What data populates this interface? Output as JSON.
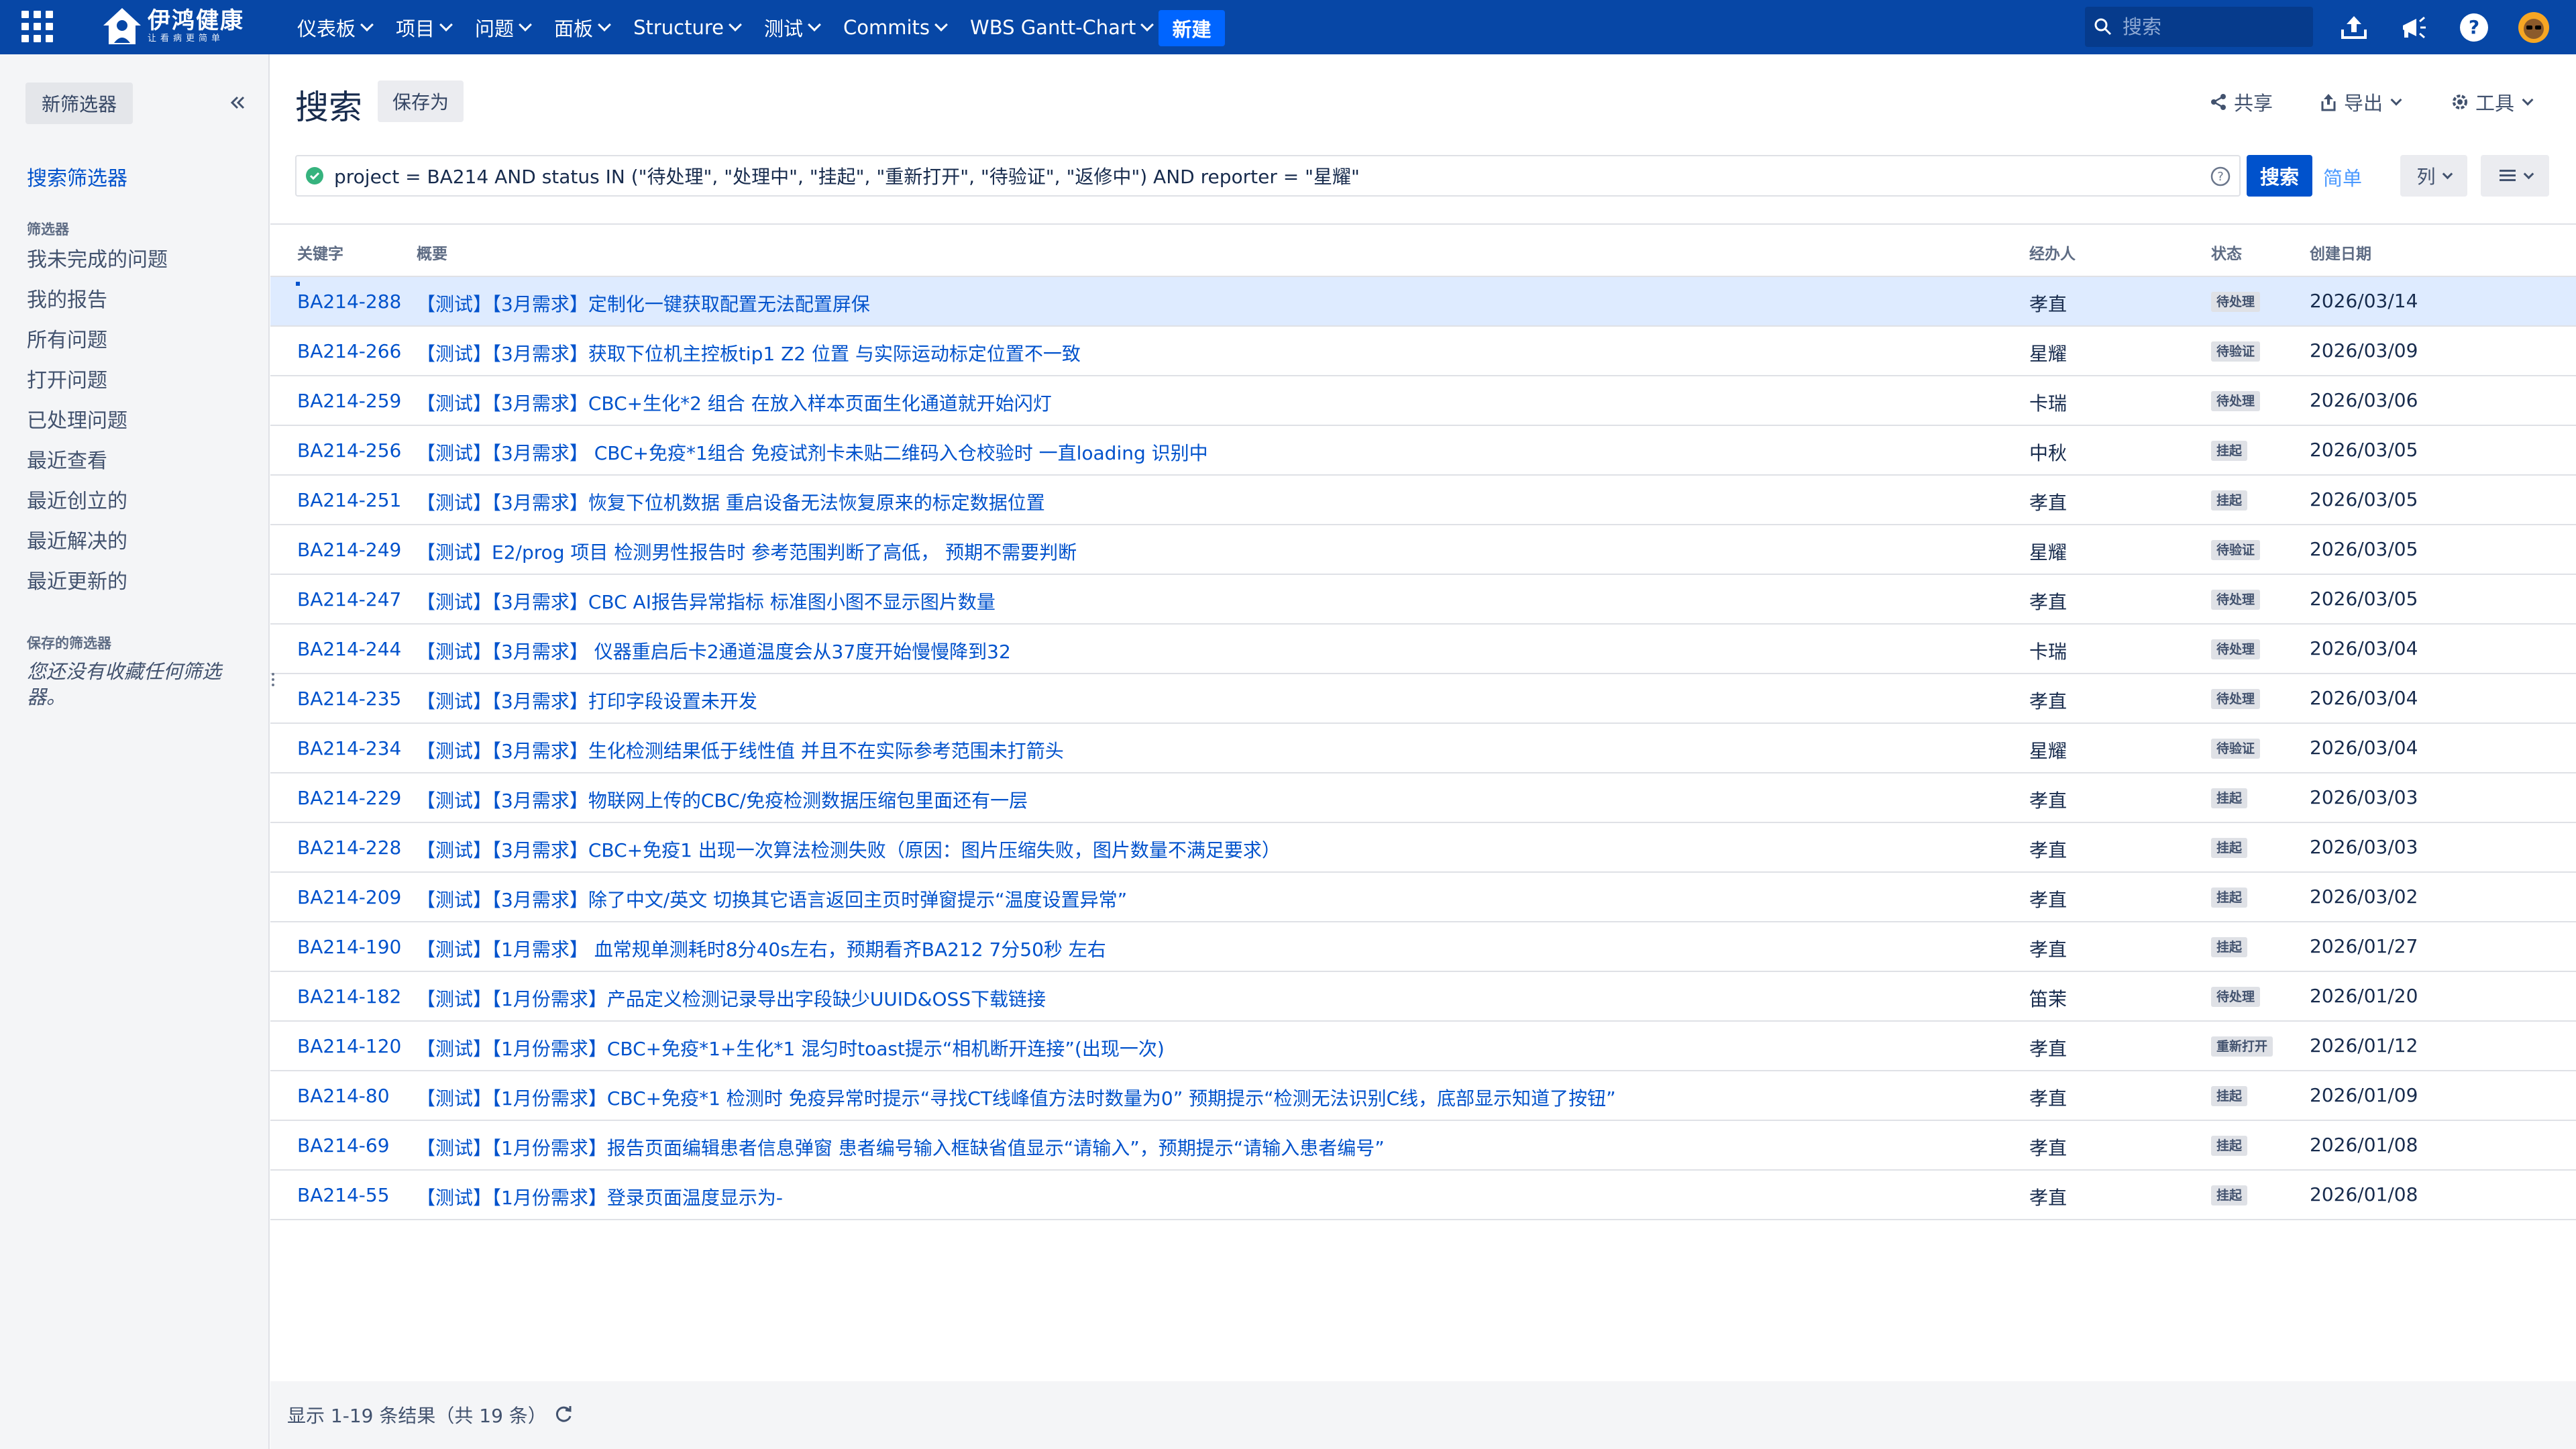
{
  "brand": {
    "name": "伊鸿健康",
    "tagline": "让看病更简单"
  },
  "nav": {
    "menus": [
      "仪表板",
      "项目",
      "问题",
      "面板",
      "Structure",
      "测试",
      "Commits",
      "WBS Gantt-Chart"
    ],
    "create_label": "新建",
    "search_placeholder": "搜索"
  },
  "sidebar": {
    "new_filter_label": "新筛选器",
    "find_filters_label": "搜索筛选器",
    "filters_heading": "筛选器",
    "filters": [
      "我未完成的问题",
      "我的报告",
      "所有问题",
      "打开问题",
      "已处理问题",
      "最近查看",
      "最近创立的",
      "最近解决的",
      "最近更新的"
    ],
    "saved_heading": "保存的筛选器",
    "saved_empty": "您还没有收藏任何筛选器。"
  },
  "header": {
    "title": "搜索",
    "save_as_label": "保存为",
    "share_label": "共享",
    "export_label": "导出",
    "tools_label": "工具"
  },
  "query": {
    "jql": "project = BA214 AND status IN (\"待处理\", \"处理中\", \"挂起\", \"重新打开\", \"待验证\", \"返修中\") AND reporter = \"星耀\"",
    "search_label": "搜索",
    "basic_label": "简单",
    "columns_label": "列"
  },
  "table": {
    "headers": {
      "key": "关键字",
      "summary": "概要",
      "assignee": "经办人",
      "status": "状态",
      "created": "创建日期"
    },
    "rows": [
      {
        "key": "BA214-288",
        "summary": "【测试】【3月需求】定制化一键获取配置无法配置屏保",
        "assignee": "孝直",
        "status": "待处理",
        "created": "2026/03/14"
      },
      {
        "key": "BA214-266",
        "summary": "【测试】【3月需求】获取下位机主控板tip1 Z2 位置 与实际运动标定位置不一致",
        "assignee": "星耀",
        "status": "待验证",
        "created": "2026/03/09"
      },
      {
        "key": "BA214-259",
        "summary": "【测试】【3月需求】CBC+生化*2 组合 在放入样本页面生化通道就开始闪灯",
        "assignee": "卡瑞",
        "status": "待处理",
        "created": "2026/03/06"
      },
      {
        "key": "BA214-256",
        "summary": "【测试】【3月需求】 CBC+免疫*1组合 免疫试剂卡未贴二维码入仓校验时 一直loading 识别中",
        "assignee": "中秋",
        "status": "挂起",
        "created": "2026/03/05"
      },
      {
        "key": "BA214-251",
        "summary": "【测试】【3月需求】恢复下位机数据 重启设备无法恢复原来的标定数据位置",
        "assignee": "孝直",
        "status": "挂起",
        "created": "2026/03/05"
      },
      {
        "key": "BA214-249",
        "summary": "【测试】E2/prog 项目 检测男性报告时 参考范围判断了高低， 预期不需要判断",
        "assignee": "星耀",
        "status": "待验证",
        "created": "2026/03/05"
      },
      {
        "key": "BA214-247",
        "summary": "【测试】【3月需求】CBC AI报告异常指标 标准图小图不显示图片数量",
        "assignee": "孝直",
        "status": "待处理",
        "created": "2026/03/05"
      },
      {
        "key": "BA214-244",
        "summary": "【测试】【3月需求】 仪器重启后卡2通道温度会从37度开始慢慢降到32",
        "assignee": "卡瑞",
        "status": "待处理",
        "created": "2026/03/04"
      },
      {
        "key": "BA214-235",
        "summary": "【测试】【3月需求】打印字段设置未开发",
        "assignee": "孝直",
        "status": "待处理",
        "created": "2026/03/04"
      },
      {
        "key": "BA214-234",
        "summary": "【测试】【3月需求】生化检测结果低于线性值 并且不在实际参考范围未打箭头",
        "assignee": "星耀",
        "status": "待验证",
        "created": "2026/03/04"
      },
      {
        "key": "BA214-229",
        "summary": "【测试】【3月需求】物联网上传的CBC/免疫检测数据压缩包里面还有一层",
        "assignee": "孝直",
        "status": "挂起",
        "created": "2026/03/03"
      },
      {
        "key": "BA214-228",
        "summary": "【测试】【3月需求】CBC+免疫1 出现一次算法检测失败（原因：图片压缩失败，图片数量不满足要求）",
        "assignee": "孝直",
        "status": "挂起",
        "created": "2026/03/03"
      },
      {
        "key": "BA214-209",
        "summary": "【测试】【3月需求】除了中文/英文 切换其它语言返回主页时弹窗提示“温度设置异常”",
        "assignee": "孝直",
        "status": "挂起",
        "created": "2026/03/02"
      },
      {
        "key": "BA214-190",
        "summary": "【测试】【1月需求】 血常规单测耗时8分40s左右，预期看齐BA212 7分50秒 左右",
        "assignee": "孝直",
        "status": "挂起",
        "created": "2026/01/27"
      },
      {
        "key": "BA214-182",
        "summary": "【测试】【1月份需求】产品定义检测记录导出字段缺少UUID&OSS下载链接",
        "assignee": "笛茉",
        "status": "待处理",
        "created": "2026/01/20"
      },
      {
        "key": "BA214-120",
        "summary": "【测试】【1月份需求】CBC+免疫*1+生化*1 混匀时toast提示“相机断开连接”(出现一次)",
        "assignee": "孝直",
        "status": "重新打开",
        "created": "2026/01/12"
      },
      {
        "key": "BA214-80",
        "summary": "【测试】【1月份需求】CBC+免疫*1 检测时 免疫异常时提示“寻找CT线峰值方法时数量为0” 预期提示“检测无法识别C线，底部显示知道了按钮”",
        "assignee": "孝直",
        "status": "挂起",
        "created": "2026/01/09"
      },
      {
        "key": "BA214-69",
        "summary": "【测试】【1月份需求】报告页面编辑患者信息弹窗 患者编号输入框缺省值显示“请输入”，预期提示“请输入患者编号”",
        "assignee": "孝直",
        "status": "挂起",
        "created": "2026/01/08"
      },
      {
        "key": "BA214-55",
        "summary": "【测试】【1月份需求】登录页面温度显示为-",
        "assignee": "孝直",
        "status": "挂起",
        "created": "2026/01/08"
      }
    ]
  },
  "footer": {
    "results_text": "显示 1-19 条结果（共 19 条）"
  },
  "colors": {
    "nav_bg": "#0747a6",
    "link": "#0052cc",
    "selected_row": "#deebff",
    "primary_button": "#0052cc"
  }
}
